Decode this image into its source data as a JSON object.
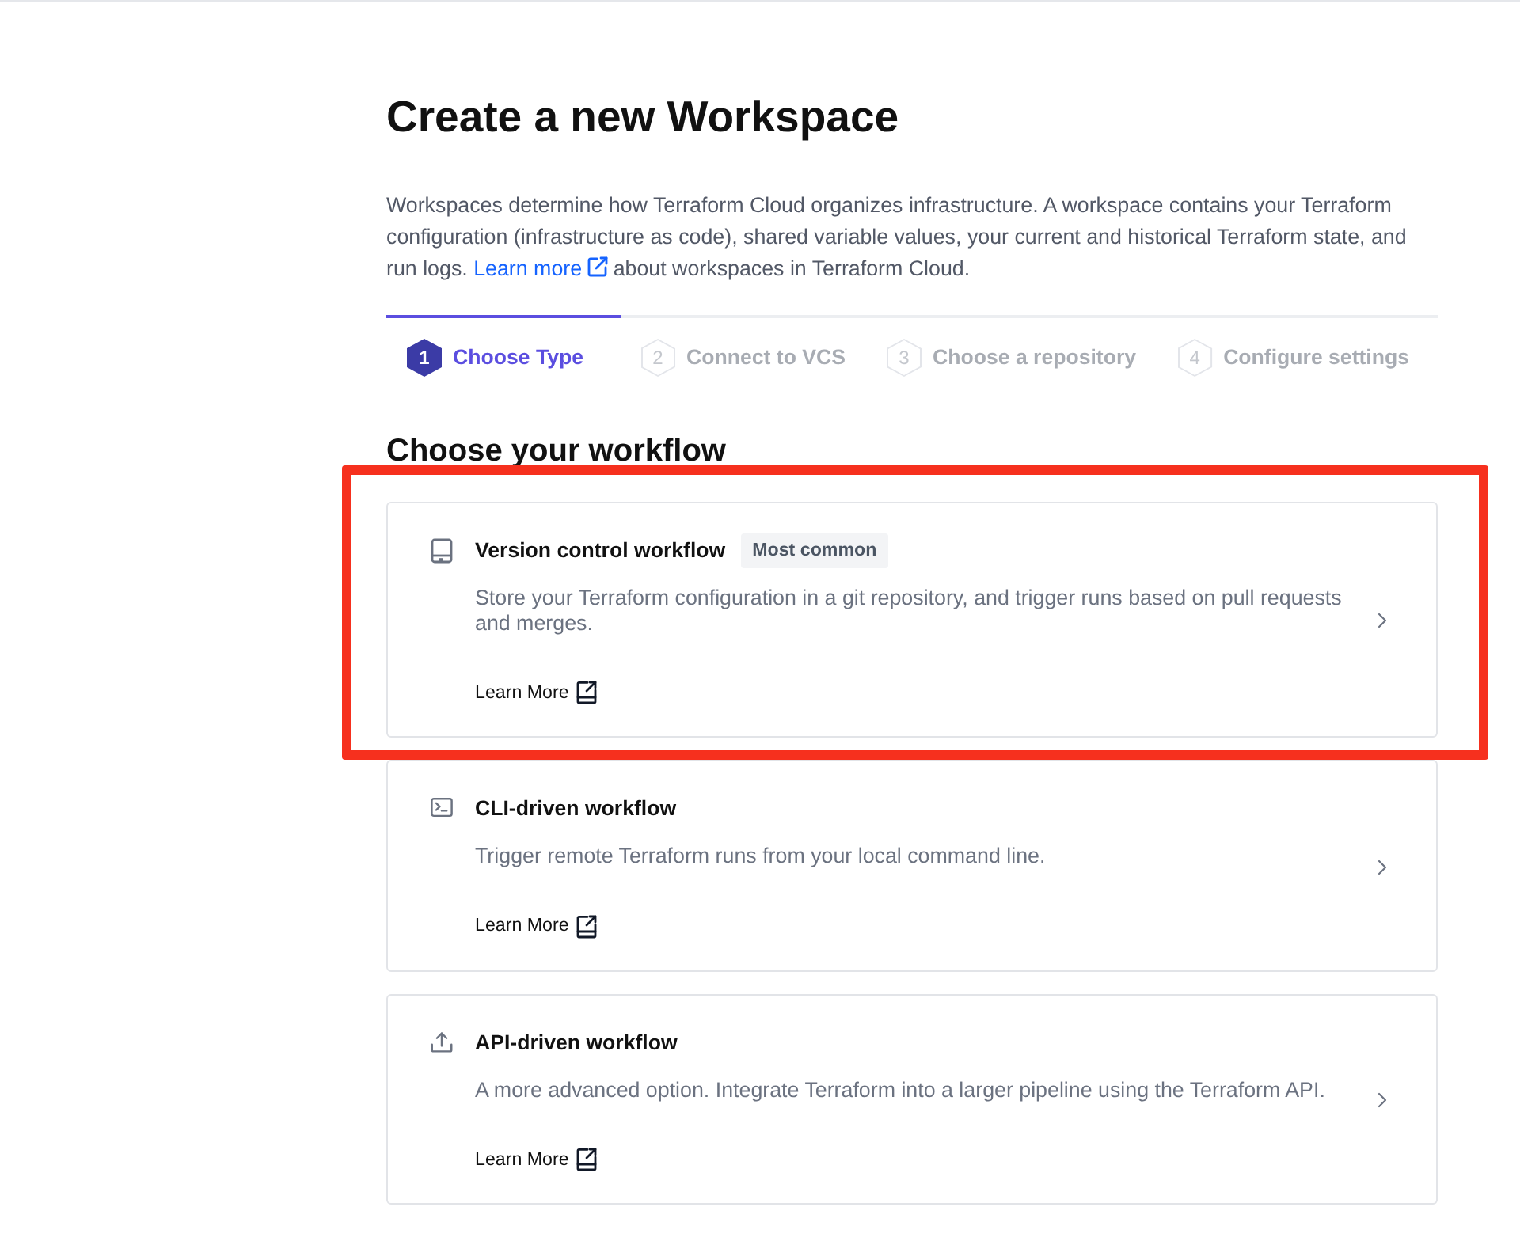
{
  "page": {
    "title": "Create a new Workspace"
  },
  "intro": {
    "text_before": "Workspaces determine how Terraform Cloud organizes infrastructure. A workspace contains your Terraform configuration (infrastructure as code), shared variable values, your current and historical Terraform state, and run logs.",
    "link": "Learn more",
    "text_after": "about workspaces in Terraform Cloud."
  },
  "steps": [
    {
      "number": "1",
      "label": "Choose Type",
      "selected": true
    },
    {
      "number": "2",
      "label": "Connect to VCS",
      "selected": false
    },
    {
      "number": "3",
      "label": "Choose a repository",
      "selected": false
    },
    {
      "number": "4",
      "label": "Configure settings",
      "selected": false
    }
  ],
  "section_title": "Choose your workflow",
  "workflows": [
    {
      "kind": "vcs",
      "title": "Version control workflow",
      "badge": "Most common",
      "description": "Store your Terraform configuration in a git repository, and trigger runs based on pull requests and merges.",
      "link": "Learn More",
      "highlighted": true
    },
    {
      "kind": "cli",
      "title": "CLI-driven workflow",
      "description": "Trigger remote Terraform runs from your local command line.",
      "link": "Learn More",
      "highlighted": false
    },
    {
      "kind": "api",
      "title": "API-driven workflow",
      "description": "A more advanced option. Integrate Terraform into a larger pipeline using the Terraform API.",
      "link": "Learn More",
      "highlighted": false
    }
  ]
}
